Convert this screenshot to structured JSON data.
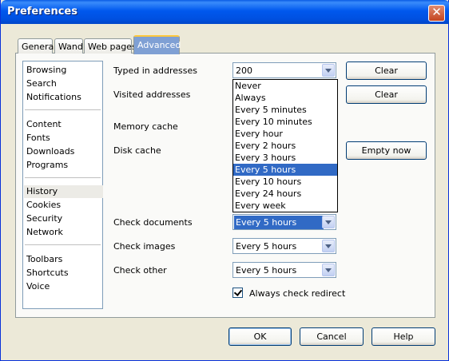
{
  "window": {
    "title": "Preferences"
  },
  "tabs": [
    {
      "label": "General"
    },
    {
      "label": "Wand"
    },
    {
      "label": "Web pages"
    },
    {
      "label": "Advanced"
    }
  ],
  "sidebar": {
    "groups": [
      [
        "Browsing",
        "Search",
        "Notifications"
      ],
      [
        "Content",
        "Fonts",
        "Downloads",
        "Programs"
      ],
      [
        "History",
        "Cookies",
        "Security",
        "Network"
      ],
      [
        "Toolbars",
        "Shortcuts",
        "Voice"
      ]
    ],
    "selected": "History"
  },
  "settings": {
    "typed_addresses_label": "Typed in addresses",
    "typed_addresses_value": "200",
    "visited_addresses_label": "Visited addresses",
    "memory_cache_label": "Memory cache",
    "disk_cache_label": "Disk cache",
    "check_documents_label": "Check documents",
    "check_documents_value": "Every 5 hours",
    "check_images_label": "Check images",
    "check_images_value": "Every 5 hours",
    "check_other_label": "Check other",
    "check_other_value": "Every 5 hours",
    "always_check_redirect_label": "Always check redirect",
    "always_check_redirect_checked": true
  },
  "side_buttons": {
    "clear_typed": "Clear",
    "clear_visited": "Clear",
    "empty_now": "Empty now"
  },
  "dropdown": {
    "options": [
      "Never",
      "Always",
      "Every 5 minutes",
      "Every 10 minutes",
      "Every hour",
      "Every 2 hours",
      "Every 3 hours",
      "Every 5 hours",
      "Every 10 hours",
      "Every 24 hours",
      "Every week"
    ],
    "selected": "Every 5 hours"
  },
  "footer": {
    "ok": "OK",
    "cancel": "Cancel",
    "help": "Help"
  }
}
